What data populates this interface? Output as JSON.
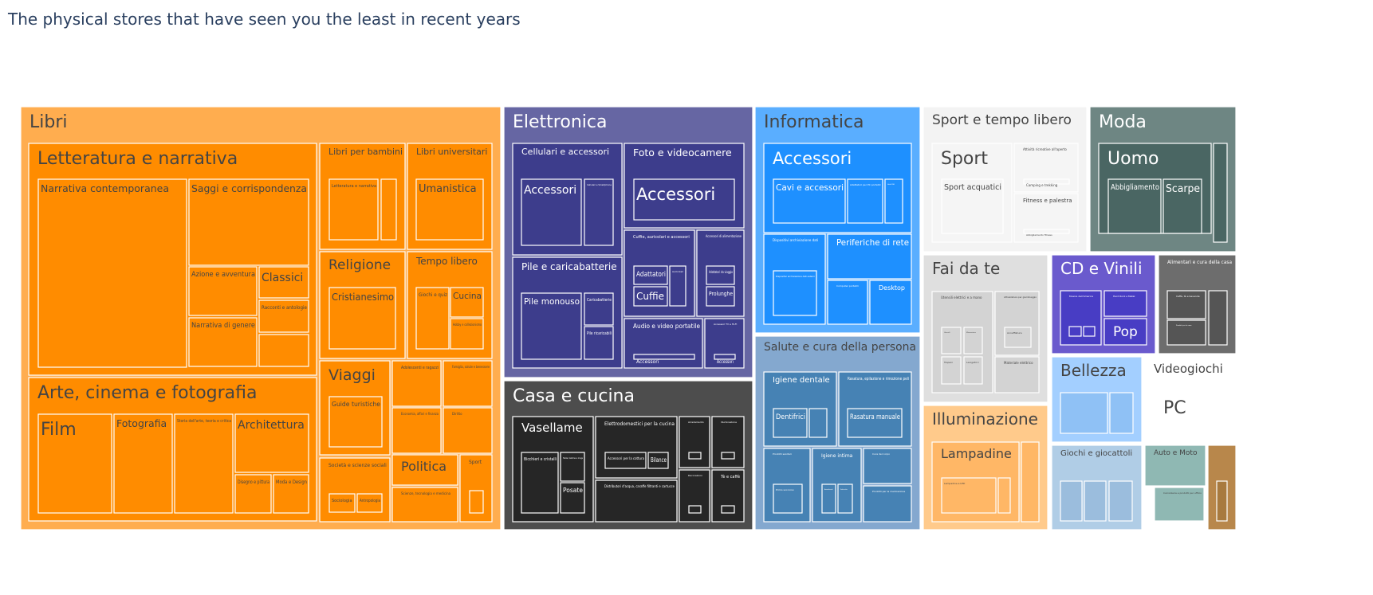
{
  "chart_data": {
    "type": "treemap",
    "title": "The physical stores that have seen you the least in recent years",
    "roots": [
      {
        "label": "Libri",
        "color": "#FFAD4F",
        "children": [
          {
            "label": "Letteratura e narrativa",
            "color": "#FF8C00",
            "children": [
              {
                "label": "Narrativa contemporanea"
              },
              {
                "label": "Saggi e corrispondenza"
              },
              {
                "label": "Azione e avventura"
              },
              {
                "label": "Classici"
              },
              {
                "label": "Racconti e antologie"
              },
              {
                "label": "Narrativa di genere"
              },
              {
                "label": ""
              }
            ]
          },
          {
            "label": "Arte, cinema e fotografia",
            "color": "#FF8C00",
            "children": [
              {
                "label": "Film"
              },
              {
                "label": "Fotografia"
              },
              {
                "label": "Storia dell'arte, teoria e critica"
              },
              {
                "label": "Architettura"
              },
              {
                "label": "Disegno e pittura"
              },
              {
                "label": "Moda e Design"
              }
            ]
          },
          {
            "label": "Libri per bambini",
            "color": "#FF8C00",
            "children": [
              {
                "label": "Letteratura e narrativa"
              },
              {
                "label": ""
              }
            ]
          },
          {
            "label": "Libri universitari",
            "color": "#FF8C00",
            "children": [
              {
                "label": "Umanistica"
              }
            ]
          },
          {
            "label": "Religione",
            "color": "#FF8C00",
            "children": [
              {
                "label": "Cristianesimo"
              }
            ]
          },
          {
            "label": "Tempo libero",
            "color": "#FF8C00",
            "children": [
              {
                "label": "Giochi e quiz"
              },
              {
                "label": "Cucina"
              },
              {
                "label": "Hobby e collezionismo"
              }
            ]
          },
          {
            "label": "Viaggi",
            "color": "#FF8C00",
            "children": [
              {
                "label": "Guide turistiche"
              }
            ]
          },
          {
            "label": "Adolescenti e ragazzi",
            "color": "#FF8C00",
            "children": []
          },
          {
            "label": "Famiglia, salute e benessere",
            "color": "#FF8C00",
            "children": []
          },
          {
            "label": "Economia, affari e finanza",
            "color": "#FF8C00",
            "children": []
          },
          {
            "label": "Diritto",
            "color": "#FF8C00",
            "children": []
          },
          {
            "label": "Società e scienze sociali",
            "color": "#FF8C00",
            "children": [
              {
                "label": "Sociologia"
              },
              {
                "label": "Antropologia"
              }
            ]
          },
          {
            "label": "Politica",
            "color": "#FF8C00",
            "children": []
          },
          {
            "label": "Scienze, tecnologia e medicina",
            "color": "#FF8C00",
            "children": []
          },
          {
            "label": "Sport",
            "color": "#FF8C00",
            "children": [
              {
                "label": ""
              }
            ]
          }
        ]
      },
      {
        "label": "Elettronica",
        "color": "#6666A3",
        "children": [
          {
            "label": "Cellulari e accessori",
            "color": "#3D3D8C",
            "children": [
              {
                "label": "Accessori"
              },
              {
                "label": "Cellulari e Smartphone"
              }
            ]
          },
          {
            "label": "Foto e videocamere",
            "color": "#3D3D8C",
            "children": [
              {
                "label": "Accessori"
              }
            ]
          },
          {
            "label": "Pile e caricabatterie",
            "color": "#3D3D8C",
            "children": [
              {
                "label": "Pile monouso"
              },
              {
                "label": "Caricabatterie"
              },
              {
                "label": "Pile ricaricabili"
              }
            ]
          },
          {
            "label": "Cuffie, auricolari e accessori",
            "color": "#3D3D8C",
            "children": [
              {
                "label": "Adattatori"
              },
              {
                "label": "Cuffie"
              },
              {
                "label": "Auricolari"
              }
            ]
          },
          {
            "label": "Accessori di alimentazione",
            "color": "#3D3D8C",
            "children": [
              {
                "label": "Adattatori da viaggio"
              },
              {
                "label": "Prolunghe"
              }
            ]
          },
          {
            "label": "Audio e video portatile",
            "color": "#3D3D8C",
            "children": [
              {
                "label": "Accessori"
              }
            ]
          },
          {
            "label": "Accessori TV e Hi-Fi",
            "color": "#3D3D8C",
            "children": [
              {
                "label": "Accessori"
              }
            ]
          }
        ]
      },
      {
        "label": "Informatica",
        "color": "#5AAEFF",
        "children": [
          {
            "label": "Accessori",
            "color": "#1E90FF",
            "children": [
              {
                "label": "Cavi e accessori"
              },
              {
                "label": "Adattatori per PC portatili"
              },
              {
                "label": "Hub USB"
              }
            ]
          },
          {
            "label": "Dispositivi archiviazione dati",
            "color": "#1E90FF",
            "children": [
              {
                "label": "Dispositivi archiviazione dati esterni"
              }
            ]
          },
          {
            "label": "Periferiche di rete",
            "color": "#1E90FF",
            "children": []
          },
          {
            "label": "Computer portatili",
            "color": "#1E90FF",
            "children": []
          },
          {
            "label": "Desktop",
            "color": "#1E90FF",
            "children": []
          }
        ]
      },
      {
        "label": "Casa e cucina",
        "color": "#4D4D4D",
        "children": [
          {
            "label": "Vasellame",
            "color": "#262626",
            "children": [
              {
                "label": "Bicchieri e cristalli"
              },
              {
                "label": "Tazze, tazzine e mugs"
              },
              {
                "label": "Posate"
              }
            ]
          },
          {
            "label": "Elettrodomestici per la cucina",
            "color": "#262626",
            "children": [
              {
                "label": "Accessori per la cottura"
              },
              {
                "label": "Bilance"
              }
            ]
          },
          {
            "label": "Distributori d'acqua, caraffe filtranti e cartucce",
            "color": "#262626",
            "children": []
          },
          {
            "label": "Arredamento",
            "color": "#262626",
            "children": [
              {
                "label": ""
              }
            ]
          },
          {
            "label": "Illuminazione",
            "color": "#262626",
            "children": [
              {
                "label": ""
              }
            ]
          },
          {
            "label": "Decorazioni",
            "color": "#262626",
            "children": [
              {
                "label": ""
              }
            ]
          },
          {
            "label": "Tè e caffè",
            "color": "#262626",
            "children": [
              {
                "label": ""
              }
            ]
          }
        ]
      },
      {
        "label": "Salute e cura della persona",
        "color": "#84A8CF",
        "children": [
          {
            "label": "Igiene dentale",
            "color": "#4682B4",
            "children": [
              {
                "label": "Dentifrici"
              },
              {
                "label": ""
              }
            ]
          },
          {
            "label": "Rasatura, epilazione e rimozione peli",
            "color": "#4682B4",
            "children": [
              {
                "label": "Rasatura manuale"
              }
            ]
          },
          {
            "label": "Prodotti sanitari",
            "color": "#4682B4",
            "children": [
              {
                "label": "Primo soccorso"
              }
            ]
          },
          {
            "label": "Igiene intima",
            "color": "#4682B4",
            "children": [
              {
                "label": "Assorbenti"
              },
              {
                "label": "Salviette"
              }
            ]
          },
          {
            "label": "Cura del corpo",
            "color": "#4682B4",
            "children": []
          },
          {
            "label": "Prodotti per la medicazione",
            "color": "#4682B4",
            "children": []
          }
        ]
      },
      {
        "label": "Sport e tempo libero",
        "color": "#F3F3F3",
        "children": [
          {
            "label": "Sport",
            "color": "#F5F5F5",
            "children": [
              {
                "label": "Sport acquatici"
              }
            ]
          },
          {
            "label": "Attività ricreative all'aperto",
            "color": "#F5F5F5",
            "children": [
              {
                "label": "Camping e trekking"
              }
            ]
          },
          {
            "label": "Fitness e palestra",
            "color": "#F5F5F5",
            "children": [
              {
                "label": "Abbigliamento fitness"
              }
            ]
          }
        ]
      },
      {
        "label": "Fai da te",
        "color": "#DFDFDF",
        "children": [
          {
            "label": "Utensili elettrici e a mano",
            "color": "#D3D3D3",
            "children": [
              {
                "label": "Utensili"
              },
              {
                "label": "Misurazione"
              },
              {
                "label": "Trapani"
              },
              {
                "label": "Levigatrici"
              }
            ]
          },
          {
            "label": "Attrezzature per giardinaggio",
            "color": "#D3D3D3",
            "children": [
              {
                "label": "Annaffiatura"
              }
            ]
          },
          {
            "label": "Materiale elettrico",
            "color": "#D3D3D3",
            "children": []
          }
        ]
      },
      {
        "label": "Illuminazione",
        "color": "#FFCA8B",
        "children": [
          {
            "label": "Lampadine",
            "color": "#FFB766",
            "children": [
              {
                "label": "Lampadine a LED"
              },
              {
                "label": ""
              },
              {
                "label": ""
              }
            ]
          },
          {
            "label": "",
            "color": "#FFB766",
            "children": []
          }
        ]
      },
      {
        "label": "Moda",
        "color": "#6E8683",
        "children": [
          {
            "label": "Uomo",
            "color": "#4A6663",
            "children": [
              {
                "label": "Abbigliamento"
              },
              {
                "label": "Scarpe"
              }
            ]
          },
          {
            "label": "",
            "color": "#4A6663",
            "children": []
          }
        ]
      },
      {
        "label": "CD e Vinili",
        "color": "#6A5ACD",
        "children": [
          {
            "label": "Musica dell'America",
            "color": "#483DC4",
            "children": [
              {
                "label": ""
              },
              {
                "label": ""
              }
            ]
          },
          {
            "label": "Hard Rock e Metal",
            "color": "#483DC4",
            "children": []
          },
          {
            "label": "Pop",
            "color": "#483DC4",
            "children": []
          }
        ]
      },
      {
        "label": "Alimentari e cura della casa",
        "color": "#6D6D6D",
        "children": [
          {
            "label": "Caffè, tè e bevande",
            "color": "#555555",
            "children": []
          },
          {
            "label": "Prodotti per la casa",
            "color": "#555555",
            "children": []
          },
          {
            "label": "",
            "color": "#555555",
            "children": []
          }
        ]
      },
      {
        "label": "Bellezza",
        "color": "#A3CFFF",
        "children": [
          {
            "label": "",
            "color": "#8FC1F5",
            "children": []
          },
          {
            "label": "",
            "color": "#8FC1F5",
            "children": []
          }
        ]
      },
      {
        "label": "Videogiochi",
        "color": "#FFFFFF",
        "children": [
          {
            "label": "PC",
            "color": "#FFFFFF",
            "children": []
          }
        ]
      },
      {
        "label": "Giochi e giocattoli",
        "color": "#B0CDE6",
        "children": [
          {
            "label": "",
            "color": "#9BBDDD",
            "children": []
          },
          {
            "label": "",
            "color": "#9BBDDD",
            "children": []
          },
          {
            "label": "",
            "color": "#9BBDDD",
            "children": []
          }
        ]
      },
      {
        "label": "Auto e Moto",
        "color": "#8FB8B3",
        "children": [
          {
            "label": "Carrozzeria e prodotti per ufficio",
            "color": "#8FB8B3",
            "children": []
          }
        ]
      },
      {
        "label": "",
        "color": "#B8874B",
        "children": [
          {
            "label": "",
            "color": "#A87A3F",
            "children": []
          }
        ]
      }
    ]
  }
}
